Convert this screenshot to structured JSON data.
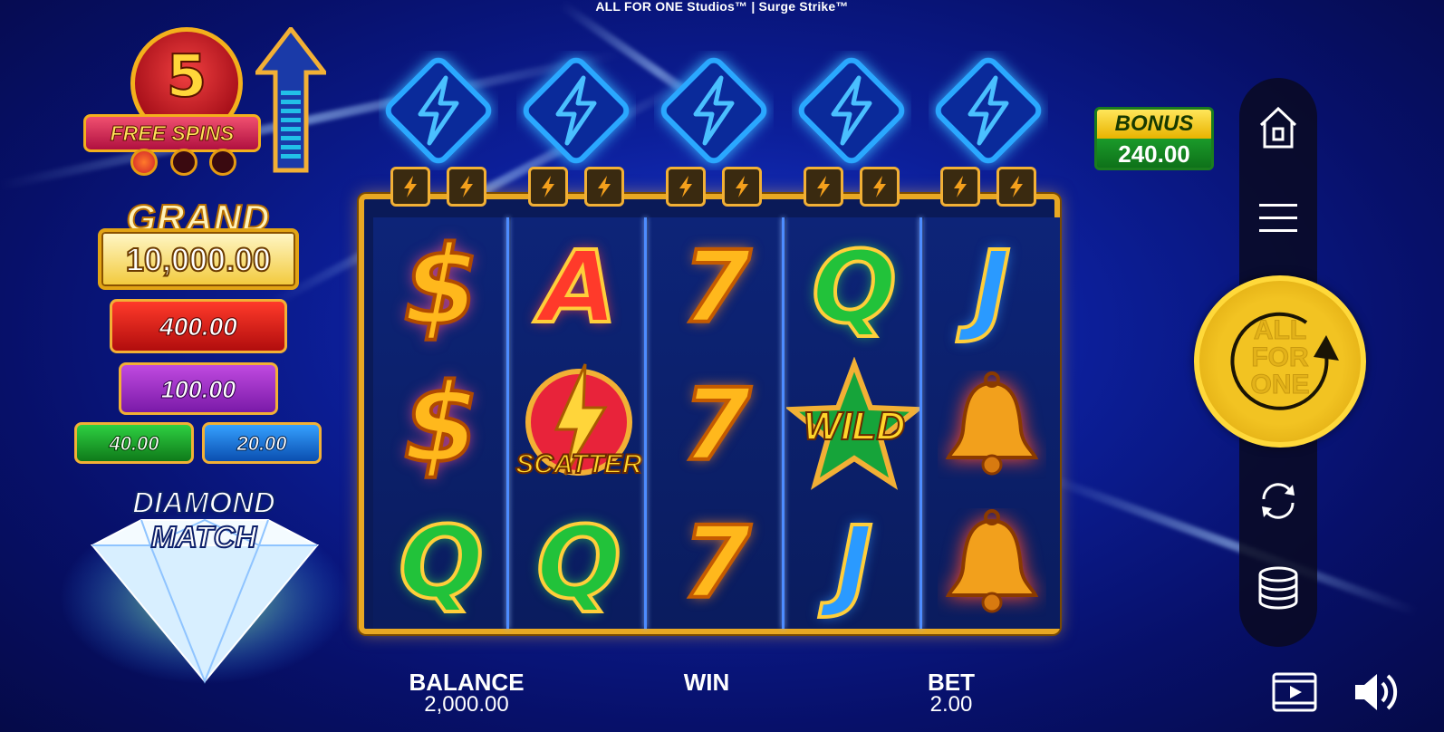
{
  "title": "ALL FOR ONE Studios™ | Surge Strike™",
  "free_spins": {
    "count": "5",
    "label": "FREE SPINS",
    "progress_filled": 1,
    "progress_total": 3
  },
  "jackpots": {
    "grand_label": "GRAND",
    "grand_value": "10,000.00",
    "major_value": "400.00",
    "minor_value": "100.00",
    "mini_green_value": "40.00",
    "mini_blue_value": "20.00"
  },
  "diamond_match": {
    "line1": "DIAMOND",
    "line2": "MATCH"
  },
  "bonus": {
    "label": "BONUS",
    "value": "240.00"
  },
  "reels": [
    [
      "$",
      "$",
      "Q"
    ],
    [
      "A",
      "SCATTER",
      "Q"
    ],
    [
      "7",
      "7",
      "7"
    ],
    [
      "Q",
      "WILD",
      "J"
    ],
    [
      "J",
      "bell",
      "bell"
    ]
  ],
  "spin_button": {
    "lines": [
      "ALL",
      "FOR",
      "ONE"
    ]
  },
  "footer": {
    "balance_label": "BALANCE",
    "balance_value": "2,000.00",
    "win_label": "WIN",
    "bet_label": "BET",
    "bet_value": "2.00"
  },
  "icons": {
    "home": "home-icon",
    "menu": "menu-icon",
    "autoplay": "autoplay-icon",
    "bet": "coins-icon",
    "replay": "video-icon",
    "sound": "sound-icon"
  },
  "colors": {
    "gold": "#f2b035",
    "spin": "#f2c322",
    "panel": "#0a0a1e"
  }
}
